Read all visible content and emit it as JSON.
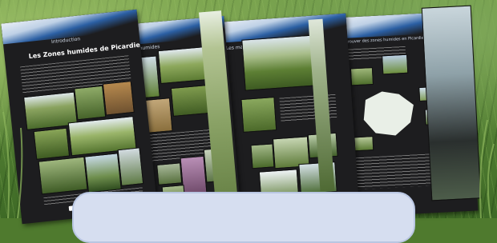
{
  "panels": [
    {
      "title": "Introduction",
      "subtitle": "Les Zones humides de Picardie"
    },
    {
      "title": "Les zones humides",
      "subtitle": ""
    },
    {
      "title": "Les marais",
      "subtitle": ""
    },
    {
      "title": "Où trouver des zones humides en Picardie ?",
      "subtitle": ""
    }
  ],
  "colors": {
    "panel": "#1d1d1f",
    "header_blue": "#2b5fa3",
    "caption_box": "#d6def0",
    "grass": "#5d8a36"
  }
}
